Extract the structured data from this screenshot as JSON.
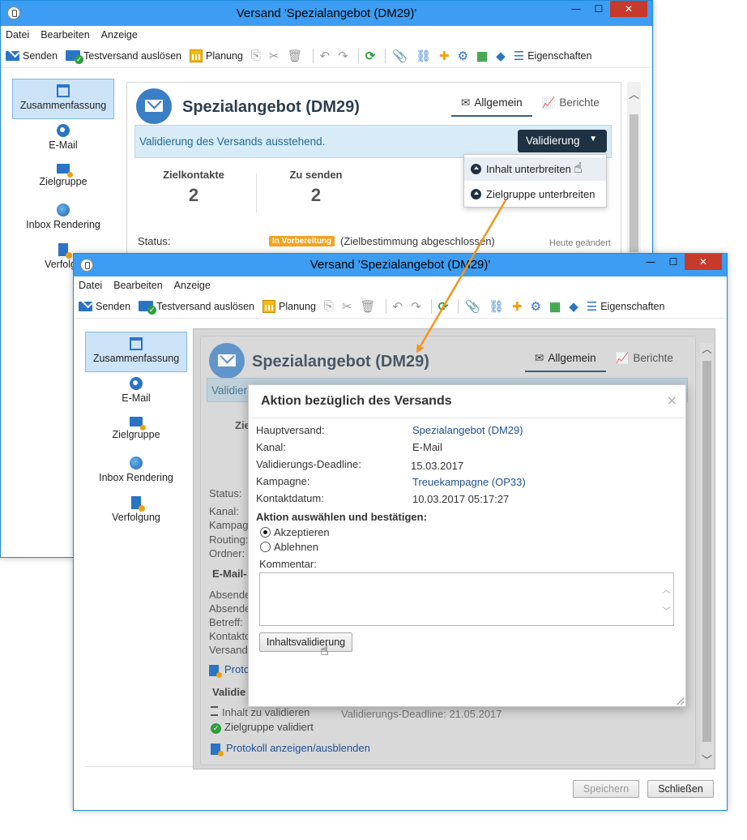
{
  "window": {
    "title": "Versand 'Spezialangebot (DM29)'",
    "controls": {
      "minimize": "—",
      "maximize": "☐",
      "close": "✕"
    }
  },
  "menu": [
    "Datei",
    "Bearbeiten",
    "Anzeige"
  ],
  "toolbar": {
    "send": "Senden",
    "test_send": "Testversand auslösen",
    "planning": "Planung",
    "properties": "Eigenschaften"
  },
  "sidebar": [
    {
      "label": "Zusammenfassung",
      "icon": "summary-icon"
    },
    {
      "label": "E-Mail",
      "icon": "email-icon"
    },
    {
      "label": "Zielgruppe",
      "icon": "target-icon"
    },
    {
      "label": "Inbox Rendering",
      "icon": "globe-icon"
    },
    {
      "label": "Verfolgung",
      "icon": "tracking-icon"
    }
  ],
  "back": {
    "heading": "Spezialangebot (DM29)",
    "tabs": [
      "Allgemein",
      "Berichte"
    ],
    "banner": "Validierung des Versands ausstehend.",
    "validate_button": "Validierung",
    "dropdown": [
      "Inhalt unterbreiten",
      "Zielgruppe unterbreiten"
    ],
    "stats": [
      {
        "label": "Zielkontakte",
        "value": "2"
      },
      {
        "label": "Zu senden",
        "value": "2"
      }
    ],
    "status_label": "Status:",
    "status_badge": "In Vorbereitung",
    "status_text": "(Zielbestimmung abgeschlossen)",
    "changed": "Heute geändert",
    "sidebar_partial": "Verfolgu"
  },
  "front": {
    "heading": "Spezialangebot (DM29)",
    "tabs": [
      "Allgemein",
      "Berichte"
    ],
    "bg_labels": {
      "banner_partial": "Validier",
      "stat_partial": "Ziel",
      "status": "Status:",
      "kanal": "Kanal:",
      "kampagne": "Kampag",
      "routing": "Routing:",
      "ordner": "Ordner:",
      "email_section": "E-Mail-",
      "absender1": "Absende",
      "absender2": "Absende",
      "betreff": "Betreff:",
      "kontakt": "Kontakto",
      "versand": "Versand",
      "proto_partial": "Proto",
      "valid_section": "Validie",
      "inhalt_validieren": "Inhalt zu validieren",
      "deadline_bg": "Validierungs-Deadline: 21.05.2017",
      "zielgruppe_validiert": "Zielgruppe validiert",
      "protokoll": "Protokoll anzeigen/ausblenden"
    },
    "footer": {
      "save": "Speichern",
      "close": "Schließen"
    }
  },
  "modal": {
    "title": "Aktion bezüglich des Versands",
    "close": "×",
    "fields": [
      {
        "label": "Hauptversand:",
        "value": "Spezialangebot (DM29)",
        "link": true
      },
      {
        "label": "Kanal:",
        "value": "E-Mail",
        "link": false
      },
      {
        "label": "Validierungs-Deadline:",
        "value": "15.03.2017",
        "link": false
      },
      {
        "label": "Kampagne:",
        "value": "Treuekampagne (OP33)",
        "link": true
      },
      {
        "label": "Kontaktdatum:",
        "value": "10.03.2017 05:17:27",
        "link": false
      }
    ],
    "action_heading": "Aktion auswählen und bestätigen:",
    "options": [
      "Akzeptieren",
      "Ablehnen"
    ],
    "selected": "Akzeptieren",
    "comment_label": "Kommentar:",
    "comment_value": "",
    "submit": "Inhaltsvalidierung"
  },
  "colors": {
    "titlebar": "#3c9df2",
    "accent_dark": "#1f3243",
    "arrow": "#f0961e",
    "badge": "#f4a221",
    "link": "#1f4f8f"
  }
}
